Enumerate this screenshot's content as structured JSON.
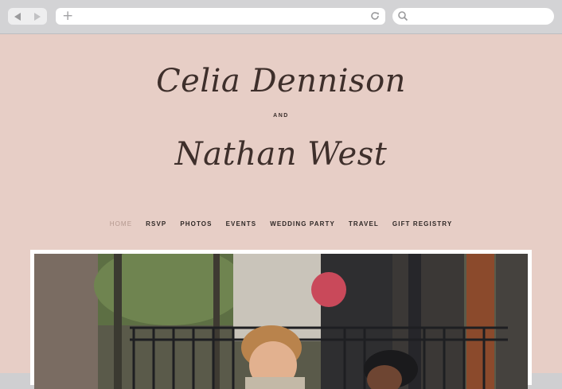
{
  "browser": {
    "address": "",
    "search_placeholder": ""
  },
  "site": {
    "name_one": "Celia Dennison",
    "connector": "AND",
    "name_two": "Nathan West",
    "nav": [
      {
        "label": "HOME",
        "active": true
      },
      {
        "label": "RSVP"
      },
      {
        "label": "PHOTOS"
      },
      {
        "label": "EVENTS"
      },
      {
        "label": "WEDDING PARTY"
      },
      {
        "label": "TRAVEL"
      },
      {
        "label": "GIFT REGISTRY"
      }
    ]
  },
  "colors": {
    "background": "#e7cec6",
    "text": "#3e2f2b",
    "active_nav": "#b3978e"
  },
  "icons": [
    "back-arrow-icon",
    "forward-arrow-icon",
    "plus-icon",
    "reload-icon",
    "search-icon"
  ]
}
